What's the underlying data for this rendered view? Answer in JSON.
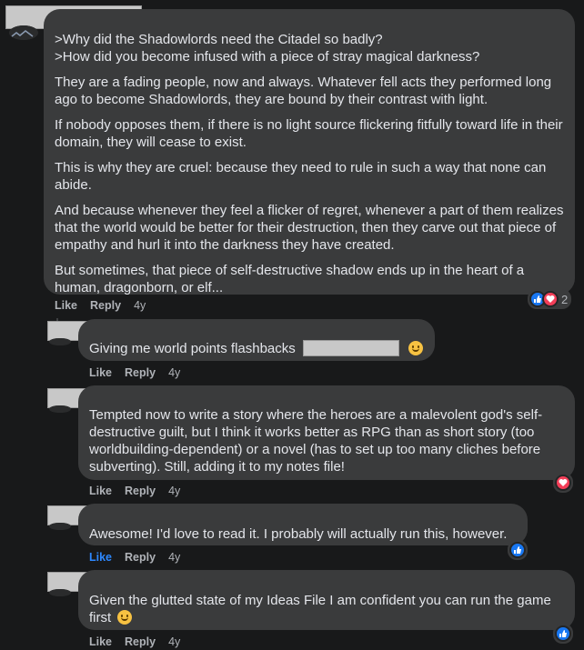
{
  "colors": {
    "background": "#18191a",
    "bubble": "#3a3b3c",
    "text": "#e4e6eb",
    "meta": "#b0b3b8",
    "like_blue": "#2d88ff",
    "love_red": "#f33e58"
  },
  "comments": [
    {
      "paragraphs": [
        ">Why did the Shadowlords need the Citadel so badly?",
        ">How did you become infused with a piece of stray magical darkness?",
        "They are a fading people, now and always. Whatever fell acts they performed long ago to become Shadowlords, they are bound by their contrast with light.",
        "If nobody opposes them, if there is no light source flickering fitfully toward life in their domain, they will cease to exist.",
        "This is why they are cruel: because they need to rule in such a way that none can abide.",
        "And because whenever they feel a flicker of regret, whenever a part of them realizes that the world would be better for their destruction, then they carve out that piece of empathy and hurl it into the darkness they have created.",
        "But sometimes, that piece of self-destructive shadow ends up in the heart of a human, dragonborn, or elf..."
      ],
      "actions": {
        "like": "Like",
        "reply": "Reply",
        "time": "4y"
      },
      "reaction_count": "2",
      "reactions": [
        "like-icon",
        "love-icon"
      ]
    },
    {
      "text": "Giving me world points flashbacks",
      "emoji": "wink-emoji",
      "actions": {
        "like": "Like",
        "reply": "Reply",
        "time": "4y"
      }
    },
    {
      "text": "Tempted now to write a story where the heroes are a malevolent god's self-destructive guilt, but I think it works better as RPG than as short story (too worldbuilding-dependent) or a novel (has to set up too many cliches before subverting). Still, adding it to my notes file!",
      "actions": {
        "like": "Like",
        "reply": "Reply",
        "time": "4y"
      },
      "reactions": [
        "love-icon"
      ]
    },
    {
      "text": "Awesome! I'd love to read it. I probably will actually run this, however.",
      "actions": {
        "like": "Like",
        "reply": "Reply",
        "time": "4y"
      },
      "liked": true,
      "reactions": [
        "like-icon"
      ]
    },
    {
      "text": "Given the glutted state of my Ideas File I am confident you can run the game first",
      "emoji": "smile-emoji",
      "actions": {
        "like": "Like",
        "reply": "Reply",
        "time": "4y"
      },
      "reactions": [
        "like-icon"
      ]
    }
  ]
}
